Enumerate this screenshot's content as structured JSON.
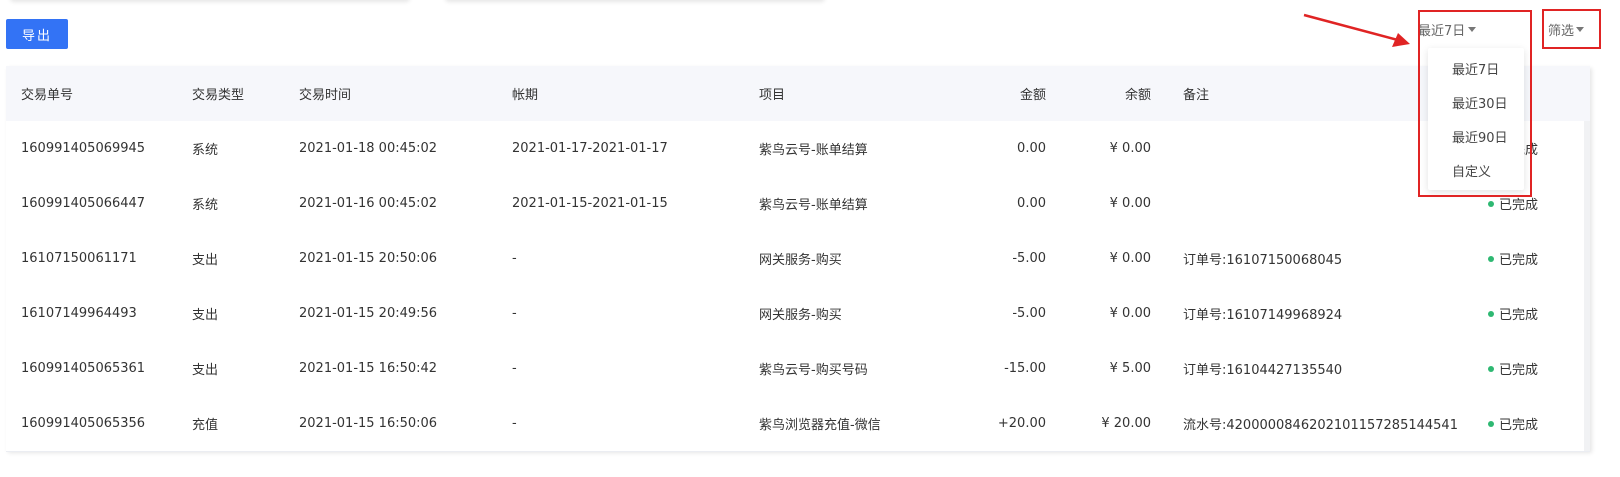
{
  "toolbar": {
    "export_label": "导出",
    "range_selected": "最近7日",
    "filter_label": "筛选"
  },
  "range_options": [
    "最近7日",
    "最近30日",
    "最近90日",
    "自定义"
  ],
  "table": {
    "headers": [
      "交易单号",
      "交易类型",
      "交易时间",
      "帐期",
      "项目",
      "金额",
      "余额",
      "备注"
    ],
    "rows": [
      {
        "id": "160991405069945",
        "type": "系统",
        "time": "2021-01-18 00:45:02",
        "period": "2021-01-17-2021-01-17",
        "item": "紫鸟云号-账单结算",
        "amount": "0.00",
        "balance": "¥ 0.00",
        "note": "",
        "status": "已完成"
      },
      {
        "id": "160991405066447",
        "type": "系统",
        "time": "2021-01-16 00:45:02",
        "period": "2021-01-15-2021-01-15",
        "item": "紫鸟云号-账单结算",
        "amount": "0.00",
        "balance": "¥ 0.00",
        "note": "",
        "status": "已完成"
      },
      {
        "id": "16107150061171",
        "type": "支出",
        "time": "2021-01-15 20:50:06",
        "period": "-",
        "item": "网关服务-购买",
        "amount": "-5.00",
        "balance": "¥ 0.00",
        "note": "订单号:16107150068045",
        "status": "已完成"
      },
      {
        "id": "16107149964493",
        "type": "支出",
        "time": "2021-01-15 20:49:56",
        "period": "-",
        "item": "网关服务-购买",
        "amount": "-5.00",
        "balance": "¥ 0.00",
        "note": "订单号:16107149968924",
        "status": "已完成"
      },
      {
        "id": "160991405065361",
        "type": "支出",
        "time": "2021-01-15 16:50:42",
        "period": "-",
        "item": "紫鸟云号-购买号码",
        "amount": "-15.00",
        "balance": "¥ 5.00",
        "note": "订单号:16104427135540",
        "status": "已完成"
      },
      {
        "id": "160991405065356",
        "type": "充值",
        "time": "2021-01-15 16:50:06",
        "period": "-",
        "item": "紫鸟浏览器充值-微信",
        "amount": "+20.00",
        "balance": "¥ 20.00",
        "note": "流水号:4200000846202101157285144541",
        "status": "已完成"
      }
    ]
  },
  "colors": {
    "primary": "#3373f5",
    "annotation": "#e02424",
    "status_done": "#2eb872"
  }
}
